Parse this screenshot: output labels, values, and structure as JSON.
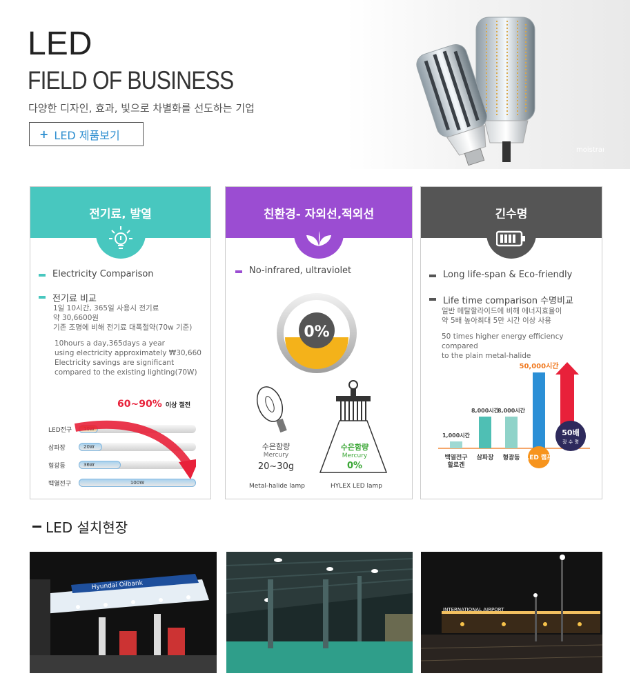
{
  "hero": {
    "title": "LED",
    "subtitle": "FIELD OF BUSINESS",
    "description": "다양한 디자인, 효과, 빛으로 차별화를 선도하는 기업",
    "button_plus": "+",
    "button_label": "LED 제품보기",
    "lamp_label": "moistran"
  },
  "cards": [
    {
      "title": "전기료, 발열",
      "bullet1": "Electricity Comparison",
      "bullet2": "전기료 비교",
      "kr_lines": [
        "1일 10시간, 365일 사용시 전기료",
        "약 30,6600원",
        "기존 조명에 비해 전기료 대폭절약(70w 기준)"
      ],
      "en_lines": [
        "10hours a day,365days a year",
        "using electricity approximately ₩30,660",
        "Electricity savings are significant",
        "compared to the existing lighting(70W)"
      ],
      "chart_title": "60~90%",
      "chart_title_suffix": "이상 절전",
      "chart_data": {
        "type": "bar",
        "categories": [
          "LED전구",
          "삼파장",
          "형광등",
          "백열전구"
        ],
        "values": [
          10,
          20,
          36,
          100
        ],
        "value_labels": [
          "10W",
          "20W",
          "36W",
          "100W"
        ],
        "ylim": [
          0,
          100
        ]
      }
    },
    {
      "title": "친환경- 자외선,적외선",
      "bullet1": "No-infrared, ultraviolet",
      "gauge_label": "0%",
      "left_lamp": {
        "line1": "수은함량",
        "line2": "Mercury",
        "value": "20~30g",
        "caption": "Metal-halide lamp"
      },
      "right_lamp": {
        "line1": "수은함량",
        "line2": "Mercury",
        "value": "0%",
        "caption": "HYLEX LED lamp"
      }
    },
    {
      "title": "긴수명",
      "bullet1": "Long life-span & Eco-friendly",
      "bullet2": "Life time comparison 수명비교",
      "kr_lines": [
        "일반 메탈할라이드에 비해 에너지효율이",
        "약 5배 높아최대 5만 시간 이상 사용"
      ],
      "en_lines": [
        "50 times higher energy efficiency compared",
        "to the plain metal-halide"
      ],
      "badge_top": "50배",
      "badge_bottom": "장 수 명",
      "chart_data": {
        "type": "bar",
        "categories": [
          "백열전구\n할로겐",
          "삼파장",
          "형광등",
          "LED 램프"
        ],
        "values": [
          1000,
          8000,
          8000,
          50000
        ],
        "value_labels": [
          "1,000시간",
          "8,000시간",
          "8,000시간",
          "50,000시간"
        ],
        "ylim": [
          0,
          50000
        ]
      }
    }
  ],
  "section": {
    "title": "LED 설치현장"
  },
  "photos": [
    {
      "sign": "Hyundai Oilbank"
    },
    {
      "sign": ""
    },
    {
      "sign": "INTERNATIONAL AIRPORT"
    }
  ],
  "colors": {
    "teal": "#48c7bf",
    "purple": "#9b4dd2",
    "gray": "#555555",
    "blue": "#2f8fd0",
    "red": "#e8213a"
  }
}
